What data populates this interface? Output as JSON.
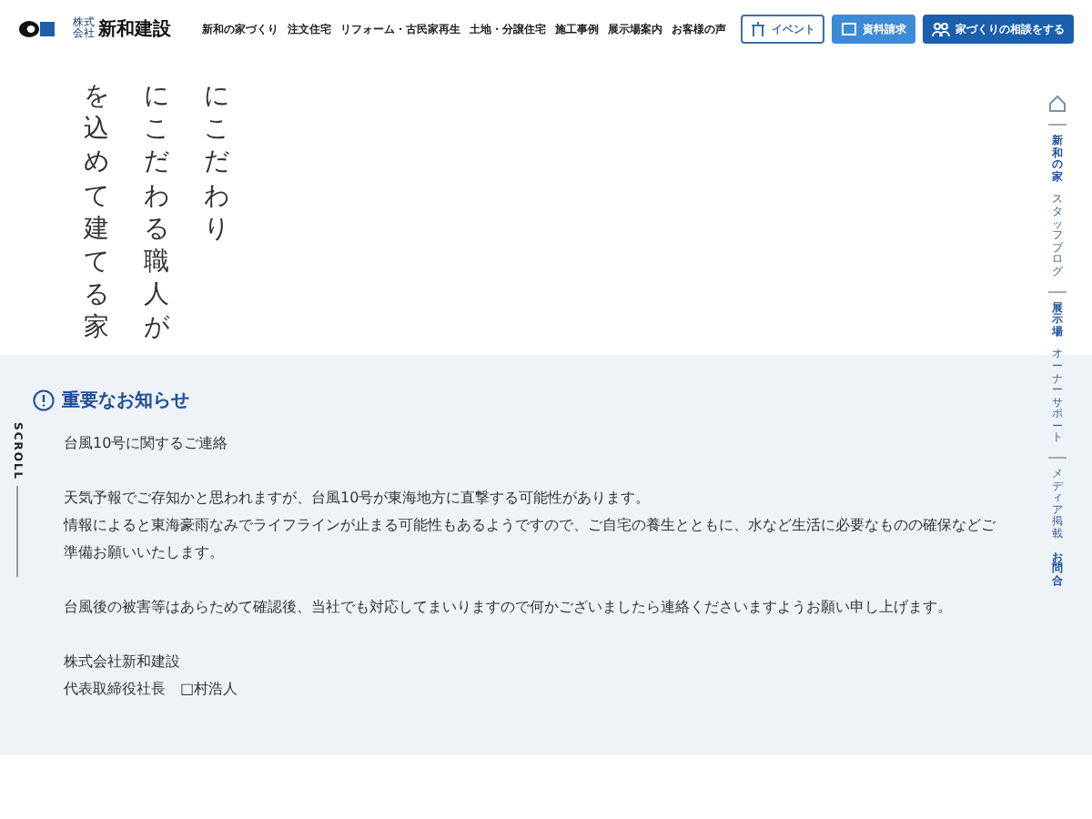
{
  "header": {
    "logo_small": "株式会社",
    "logo": "新和建設",
    "nav": [
      "新和の家づくり",
      "注文住宅",
      "リフォーム・古民家再生",
      "土地・分譲住宅",
      "施工事例",
      "展示場案内",
      "お客様の声"
    ],
    "buttons": [
      {
        "kind": "outline",
        "label": "イベント"
      },
      {
        "kind": "light",
        "label": "資料請求"
      },
      {
        "kind": "dark",
        "label": "家づくりの相談をする"
      }
    ]
  },
  "hero": {
    "columns": [
      "を込めて建てる家",
      "にこだわる職人が",
      "にこだわり"
    ],
    "scroll": "SCROLL"
  },
  "side_nav": [
    {
      "label": "新和の家",
      "emphasis": true
    },
    {
      "label": "スタッフブログ",
      "emphasis": false
    },
    {
      "label": "展示場",
      "emphasis": true
    },
    {
      "label": "オーナーサポート",
      "emphasis": false
    },
    {
      "label": "メディア掲載",
      "emphasis": false
    },
    {
      "label": "お問合",
      "emphasis": true
    }
  ],
  "notice": {
    "title": "重要なお知らせ",
    "paragraphs": [
      [
        "台風10号に関するご連絡"
      ],
      [
        "天気予報でご存知かと思われますが、台風10号が東海地方に直撃する可能性があります。",
        "情報によると東海豪雨なみでライフラインが止まる可能性もあるようですので、ご自宅の養生とともに、水など生活に必要なものの確保などご準備お願いいたします。"
      ],
      [
        "台風後の被害等はあらためて確認後、当社でも対応してまいりますので何かございましたら連絡くださいますようお願い申し上げます。"
      ],
      [
        "株式会社新和建設",
        "代表取締役社長　□村浩人"
      ]
    ]
  }
}
